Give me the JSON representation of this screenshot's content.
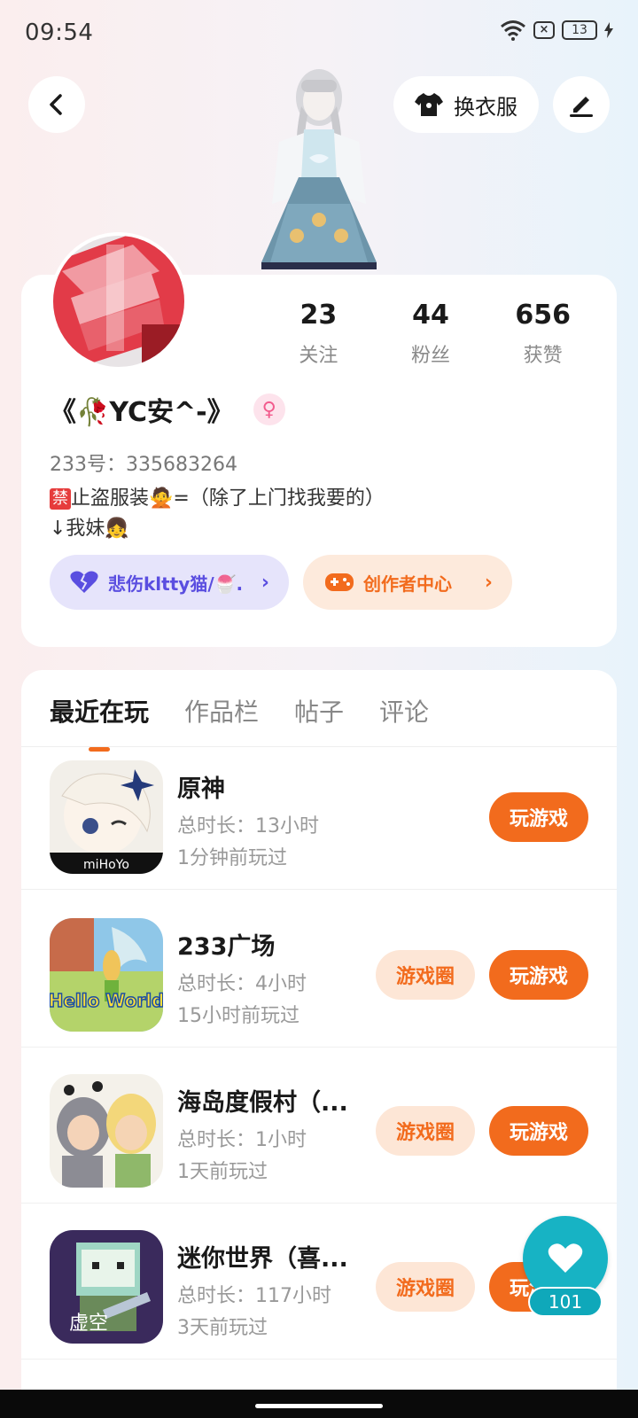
{
  "status_bar": {
    "time": "09:54",
    "battery": "13"
  },
  "header": {
    "outfit_label": "换衣服"
  },
  "profile": {
    "stats": [
      {
        "num": "23",
        "label": "关注"
      },
      {
        "num": "44",
        "label": "粉丝"
      },
      {
        "num": "656",
        "label": "获赞"
      }
    ],
    "nickname": "《🥀YC安^-》",
    "gender_symbol": "♀",
    "uid": "233号：335683264",
    "bio_line1_ban": "禁",
    "bio_line1_text": "止盗服装🙅=（除了上门找我要的）",
    "bio_line2": "↓我妹👧",
    "family_pill": "悲伤kltty猫/🍧.",
    "creator_pill": "创作者中心"
  },
  "tabs": [
    "最近在玩",
    "作品栏",
    "帖子",
    "评论"
  ],
  "games": [
    {
      "name": "原神",
      "duration": "总时长：13小时",
      "last_played": "1分钟前玩过",
      "circle_label": "",
      "play_label": "玩游戏",
      "icon_text": "miHoYo"
    },
    {
      "name": "233广场",
      "duration": "总时长：4小时",
      "last_played": "15小时前玩过",
      "circle_label": "游戏圈",
      "play_label": "玩游戏",
      "icon_text": "Hello World"
    },
    {
      "name": "海岛度假村（...",
      "duration": "总时长：1小时",
      "last_played": "1天前玩过",
      "circle_label": "游戏圈",
      "play_label": "玩游戏",
      "icon_text": ""
    },
    {
      "name": "迷你世界（喜...",
      "duration": "总时长：117小时",
      "last_played": "3天前玩过",
      "circle_label": "游戏圈",
      "play_label": "玩游戏",
      "icon_text": "虚空"
    }
  ],
  "floating": {
    "like_count": "101"
  },
  "colors": {
    "accent": "#f26b1d",
    "like": "#17b3c4",
    "family": "#5a4ee0"
  }
}
